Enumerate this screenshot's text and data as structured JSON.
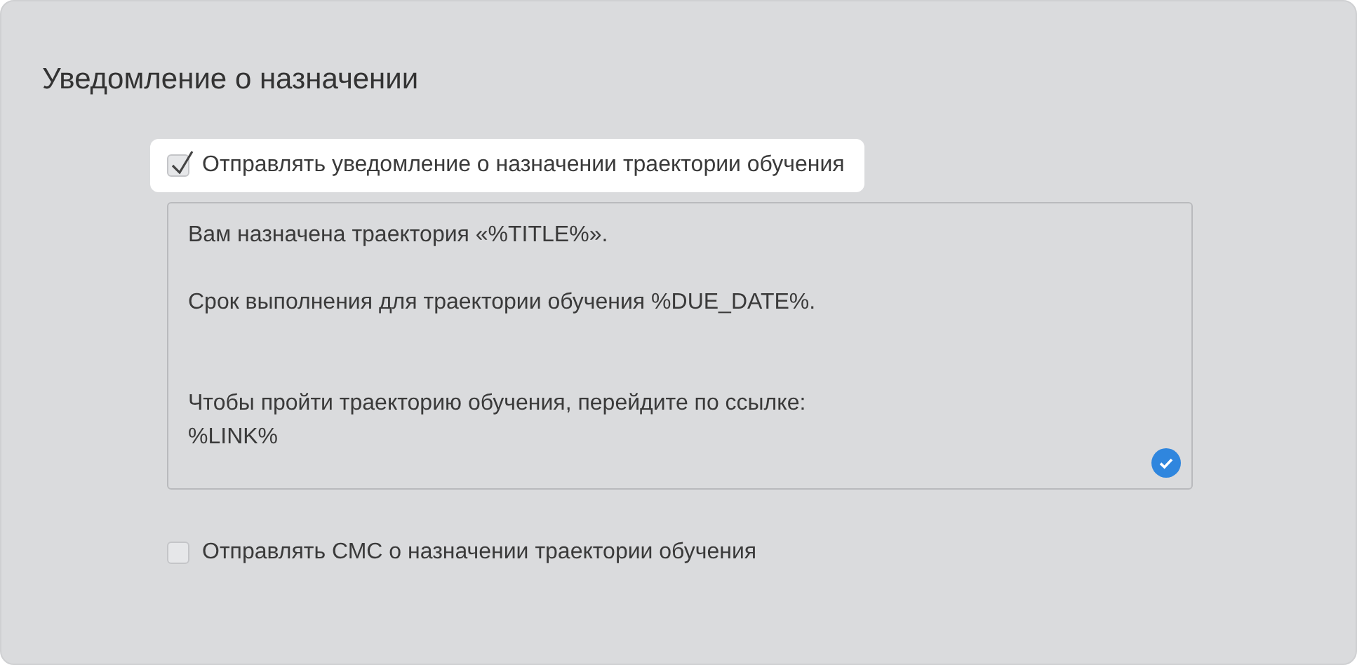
{
  "title": "Уведомление о назначении",
  "options": [
    {
      "label": "Отправлять уведомление о назначении траектории обучения",
      "checked": true,
      "highlighted": true
    },
    {
      "label": "Отправлять СМС о назначении траектории обучения",
      "checked": false,
      "highlighted": false
    }
  ],
  "message": {
    "value": "Вам назначена траектория «%TITLE%».\n\nСрок выполнения для траектории обучения %DUE_DATE%.\n\n\nЧтобы пройти траекторию обучения, перейдите по ссылке:\n%LINK%",
    "valid": true
  }
}
